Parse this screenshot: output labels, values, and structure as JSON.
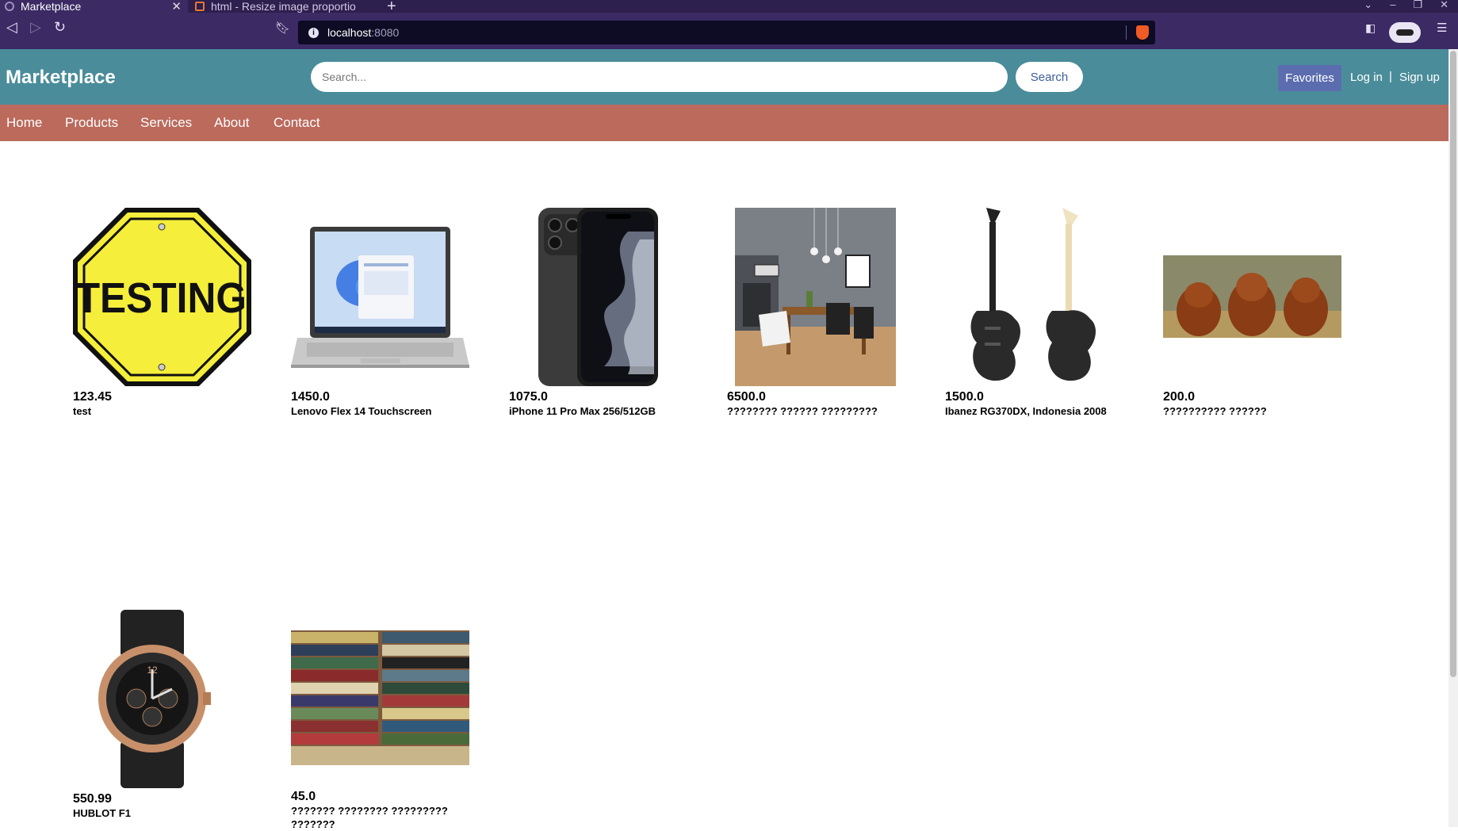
{
  "browser": {
    "tabs": [
      {
        "title": "Marketplace",
        "active": true
      },
      {
        "title": "html - Resize image proportio",
        "active": false
      }
    ],
    "new_tab_label": "+",
    "url_host": "localhost",
    "url_port": ":8080"
  },
  "header": {
    "logo": "Marketplace",
    "search_placeholder": "Search...",
    "search_button": "Search",
    "favorites": "Favorites",
    "login": "Log in",
    "separator": "|",
    "signup": "Sign up"
  },
  "menu": [
    "Home",
    "Products",
    "Services",
    "About",
    "Contact"
  ],
  "products": [
    {
      "price": "123.45",
      "name": "test",
      "image": "testing-stop-sign"
    },
    {
      "price": "1450.0",
      "name": "Lenovo Flex 14 Touchscreen",
      "image": "laptop"
    },
    {
      "price": "1075.0",
      "name": "iPhone 11 Pro Max 256/512GB",
      "image": "smartphone"
    },
    {
      "price": "6500.0",
      "name": "???????? ?????? ?????????",
      "image": "dining-room"
    },
    {
      "price": "1500.0",
      "name": "Ibanez RG370DX, Indonesia 2008",
      "image": "electric-guitars"
    },
    {
      "price": "200.0",
      "name": "?????????? ??????",
      "image": "puppies"
    },
    {
      "price": "550.99",
      "name": "HUBLOT F1",
      "image": "wristwatch"
    },
    {
      "price": "45.0",
      "name": "??????? ???????? ????????? ???????",
      "image": "book-stack"
    }
  ],
  "colors": {
    "header_bg": "#4a8c9a",
    "menu_bg": "#bb6a5c",
    "favorites_bg": "#5b6dae",
    "browser_chrome": "#3b2a63"
  }
}
